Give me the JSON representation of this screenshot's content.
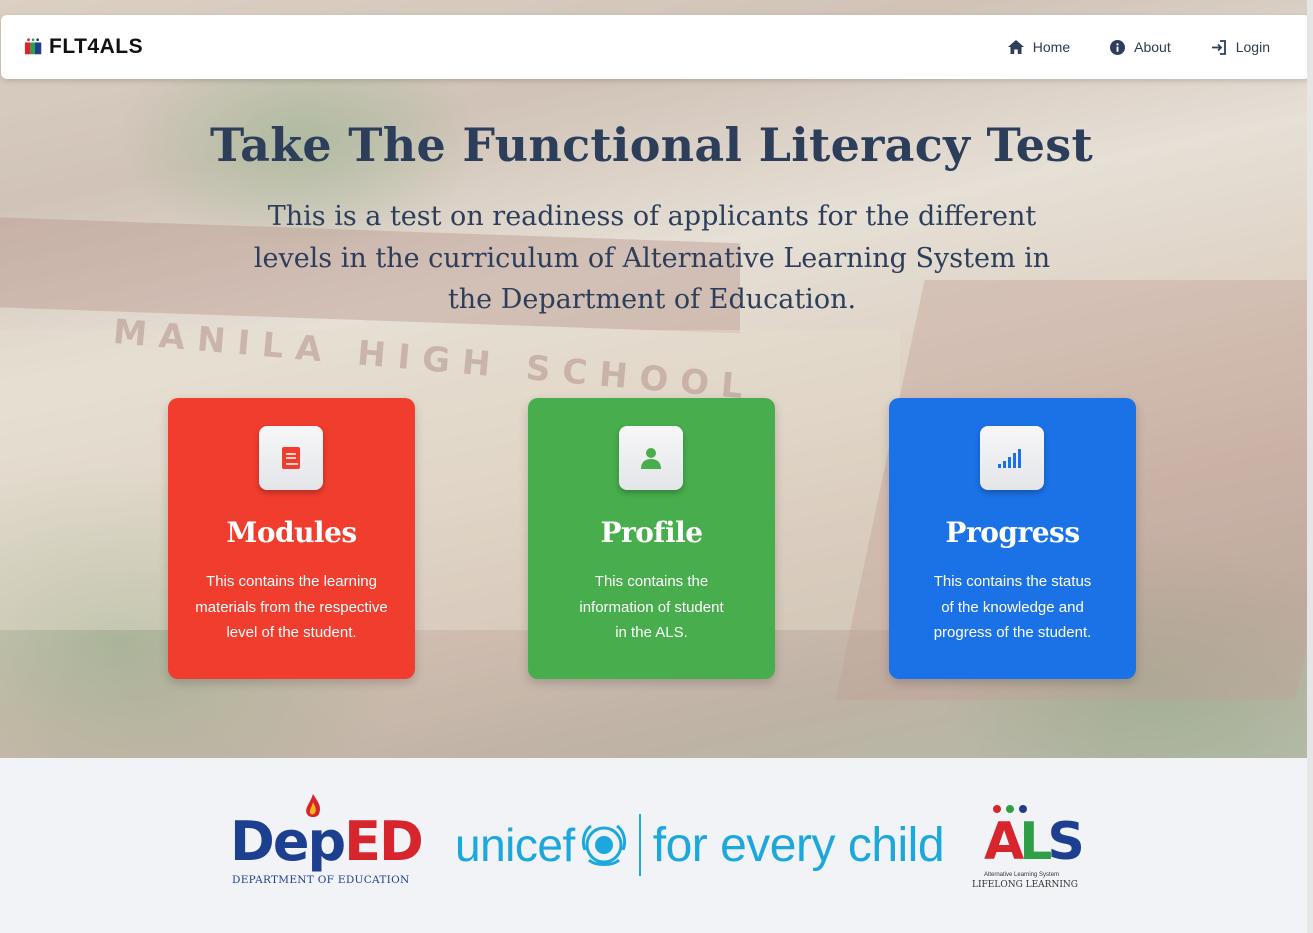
{
  "navbar": {
    "brand": "FLT4ALS",
    "links": [
      {
        "label": "Home",
        "icon": "home-icon"
      },
      {
        "label": "About",
        "icon": "info-icon"
      },
      {
        "label": "Login",
        "icon": "login-icon"
      }
    ]
  },
  "hero": {
    "title": "Take The Functional Literacy Test",
    "subtitle": "This is a test on readiness of applicants for the different levels in the curriculum of Alternative Learning System in the Department of Education.",
    "background_sign": "MANILA HIGH SCHOOL"
  },
  "cards": [
    {
      "title": "Modules",
      "text": "This contains the learning\nmaterials from the respective\nlevel of the student.",
      "icon": "book-icon",
      "color": "#f03d2e"
    },
    {
      "title": "Profile",
      "text": "This contains the\ninformation of student\nin the ALS.",
      "icon": "user-icon",
      "color": "#48ad4c"
    },
    {
      "title": "Progress",
      "text": "This contains the status\nof the knowledge and\nprogress of the student.",
      "icon": "signal-bars-icon",
      "color": "#1b72e6"
    }
  ],
  "footer": {
    "deped": {
      "word_blue": "Dep",
      "word_red": "ED",
      "caption": "DEPARTMENT OF EDUCATION"
    },
    "unicef": {
      "word": "unicef",
      "tagline": "for every child"
    },
    "als": {
      "letters_a": "A",
      "letters_l": "L",
      "letters_s": "S",
      "caption_small": "Alternative Learning System",
      "caption": "LIFELONG LEARNING"
    }
  }
}
